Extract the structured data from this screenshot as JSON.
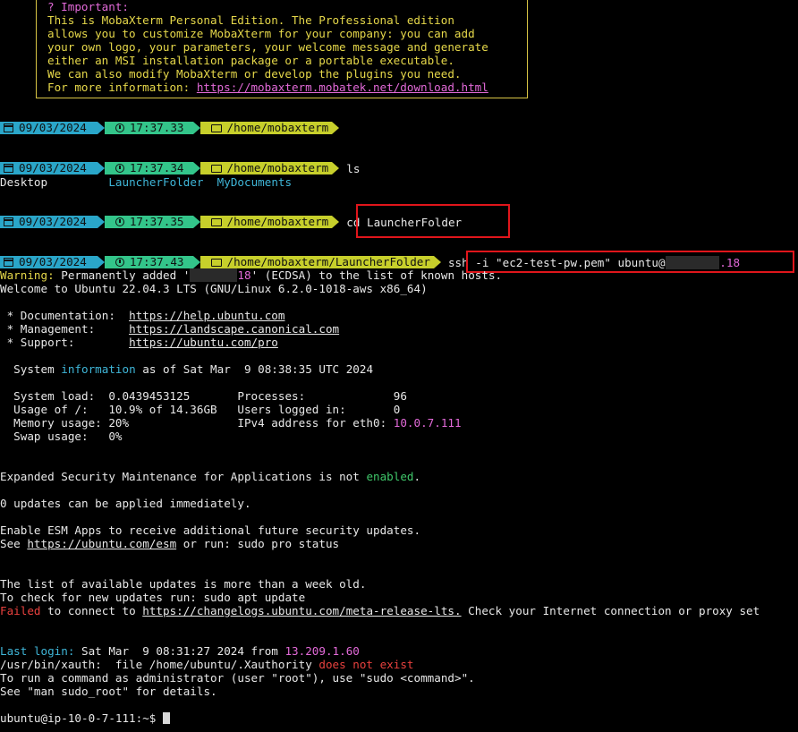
{
  "banner": {
    "heading": "? Important:",
    "lines": [
      "This is MobaXterm Personal Edition. The Professional edition",
      "allows you to customize MobaXterm for your company: you can add",
      "your own logo, your parameters, your welcome message and generate",
      "either an MSI installation package or a portable executable.",
      "We can also modify MobaXterm or develop the plugins you need."
    ],
    "more_prefix": "For more information: ",
    "more_link": "https://mobaxterm.mobatek.net/download.html"
  },
  "prompts": [
    {
      "date": "09/03/2024",
      "time": "17:37.33",
      "path": "/home/mobaxterm",
      "command": ""
    },
    {
      "date": "09/03/2024",
      "time": "17:37.34",
      "path": "/home/mobaxterm",
      "command": "ls"
    },
    {
      "date": "09/03/2024",
      "time": "17:37.35",
      "path": "/home/mobaxterm",
      "command": "cd LauncherFolder"
    },
    {
      "date": "09/03/2024",
      "time": "17:37.43",
      "path": "/home/mobaxterm/LauncherFolder",
      "command_prefix": "ssh -i \"ec2-test-pw.pem\" ubuntu@",
      "command_suffix": ".18"
    }
  ],
  "ls_output": {
    "a": "Desktop",
    "b": "LauncherFolder",
    "c": "MyDocuments"
  },
  "warning": {
    "label": "Warning:",
    "text_a": " Permanently added '",
    "ip_suffix": "18",
    "text_b": "' (ECDSA) to the list of known hosts."
  },
  "welcome": "Welcome to Ubuntu 22.04.3 LTS (GNU/Linux 6.2.0-1018-aws x86_64)",
  "docs": [
    {
      "label": " * Documentation:  ",
      "url": "https://help.ubuntu.com"
    },
    {
      "label": " * Management:     ",
      "url": "https://landscape.canonical.com"
    },
    {
      "label": " * Support:        ",
      "url": "https://ubuntu.com/pro"
    }
  ],
  "sysinfo": {
    "prefix": "  System ",
    "word": "information",
    "suffix": " as of Sat Mar  9 08:38:35 UTC 2024",
    "rows": [
      {
        "left": "  System load:  0.0439453125       ",
        "right": "Processes:             96"
      },
      {
        "left": "  Usage of /:   10.9% of 14.36GB   ",
        "right": "Users logged in:       0"
      },
      {
        "left": "  Memory usage: 20%                ",
        "right": "IPv4 address for eth0: ",
        "ip": "10.0.7.111"
      },
      {
        "left": "  Swap usage:   0%",
        "right": ""
      }
    ]
  },
  "esm": {
    "prefix": "Expanded Security Maintenance for Applications is not ",
    "word": "enabled",
    "suffix": "."
  },
  "updates": "0 updates can be applied immediately.",
  "esm_apps": "Enable ESM Apps to receive additional future security updates.",
  "esm_see": {
    "prefix": "See ",
    "url": "https://ubuntu.com/esm",
    "suffix": " or run: sudo pro status"
  },
  "list_old": "The list of available updates is more than a week old.",
  "check_new": "To check for new updates run: sudo apt update",
  "failed": {
    "word": "Failed",
    "mid": " to connect to ",
    "url": "https://changelogs.ubuntu.com/meta-release-lts.",
    "suffix": " Check your Internet connection or proxy set"
  },
  "last_login": {
    "label": "Last login:",
    "mid": " Sat Mar  9 08:31:27 2024 from ",
    "ip": "13.209.1.60"
  },
  "xauth": {
    "prefix": "/usr/bin/xauth:  file /home/ubuntu/.Xauthority ",
    "word": "does not exist"
  },
  "sudo1": "To run a command as administrator (user \"root\"), use \"sudo <command>\".",
  "sudo2": "See \"man sudo_root\" for details.",
  "final_prompt": "ubuntu@ip-10-0-7-111:~$ "
}
